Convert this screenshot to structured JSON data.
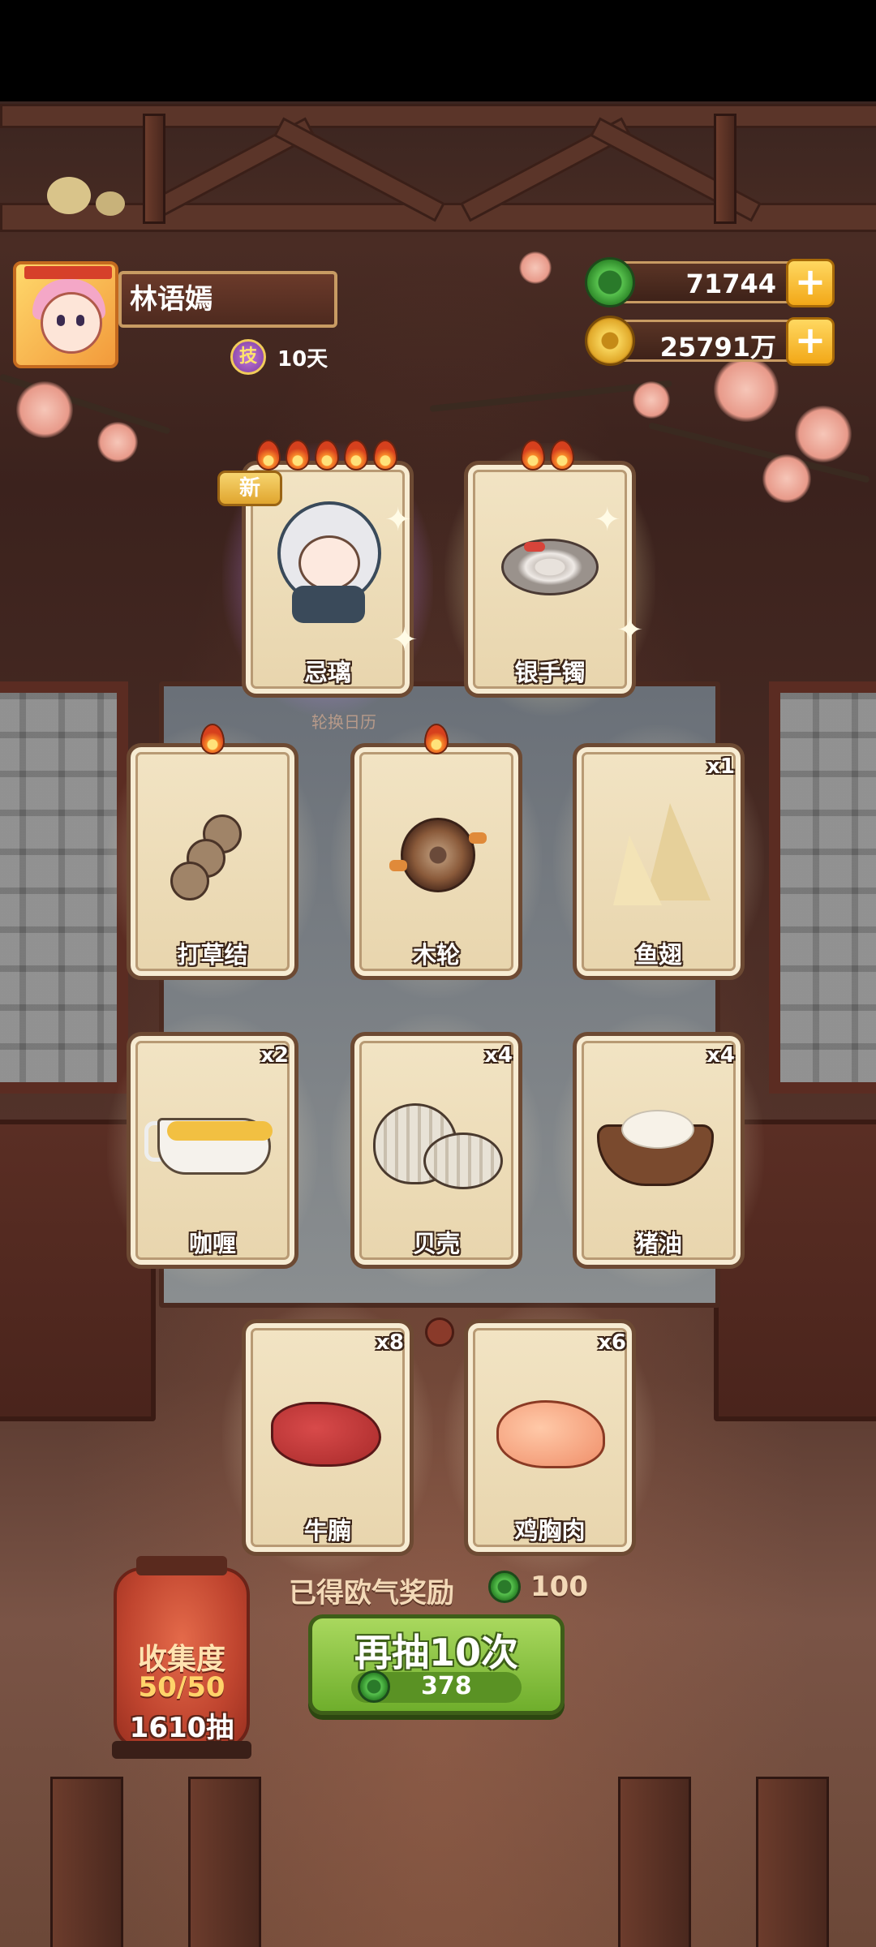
{
  "player": {
    "name": "林语嫣",
    "days": "10天",
    "skill_badge": "技"
  },
  "currency": {
    "jade": {
      "value": "71744",
      "icon": "jade-coin-icon"
    },
    "gold": {
      "value": "25791万",
      "icon": "gold-coin-icon"
    },
    "plus": "+"
  },
  "calendar_label": "轮换日历",
  "new_badge": "新",
  "cards": [
    {
      "label": "忌璃",
      "qty": "",
      "flames": 5,
      "new": true,
      "art": "character"
    },
    {
      "label": "银手镯",
      "qty": "",
      "flames": 2,
      "new": false,
      "art": "bracelet"
    },
    {
      "label": "打草结",
      "qty": "",
      "flames": 1,
      "new": false,
      "art": "grass-knot"
    },
    {
      "label": "木轮",
      "qty": "",
      "flames": 1,
      "new": false,
      "art": "wood-wheel"
    },
    {
      "label": "鱼翅",
      "qty": "x1",
      "flames": 0,
      "new": false,
      "art": "shark-fin"
    },
    {
      "label": "咖喱",
      "qty": "x2",
      "flames": 0,
      "new": false,
      "art": "curry"
    },
    {
      "label": "贝壳",
      "qty": "x4",
      "flames": 0,
      "new": false,
      "art": "shell"
    },
    {
      "label": "猪油",
      "qty": "x4",
      "flames": 0,
      "new": false,
      "art": "lard"
    },
    {
      "label": "牛腩",
      "qty": "x8",
      "flames": 0,
      "new": false,
      "art": "beef"
    },
    {
      "label": "鸡胸肉",
      "qty": "x6",
      "flames": 0,
      "new": false,
      "art": "chicken-breast"
    }
  ],
  "reward": {
    "label": "已得欧气奖励",
    "value": "100"
  },
  "draw_button": {
    "label": "再抽10次",
    "cost": "378"
  },
  "collection": {
    "title": "收集度",
    "progress": "50/50",
    "draws": "1610抽"
  }
}
